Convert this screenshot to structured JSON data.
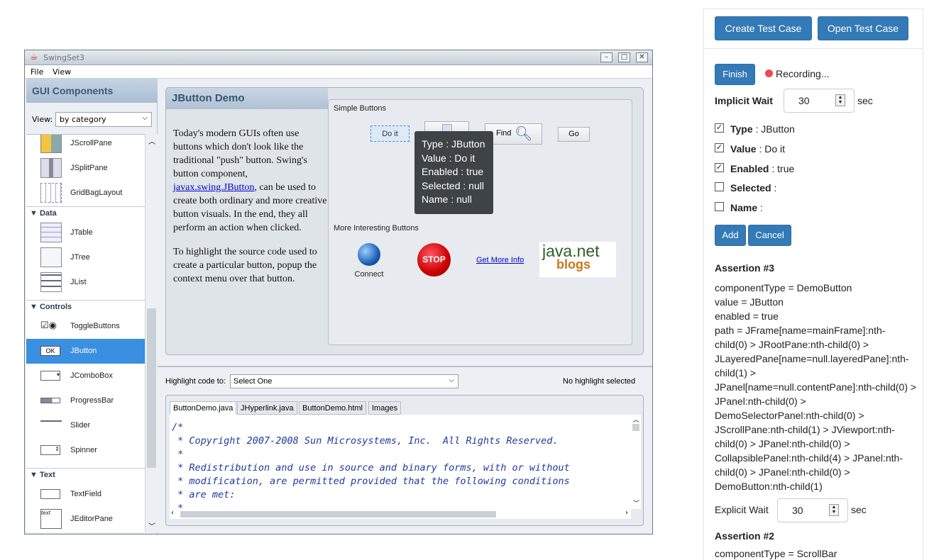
{
  "window": {
    "title": "SwingSet3",
    "menu": [
      "File",
      "View"
    ]
  },
  "left_panel": {
    "title": "GUI Components",
    "view_label": "View:",
    "view_value": "by category",
    "items_top": [
      "JScrollPane",
      "JSplitPane",
      "GridBagLayout"
    ],
    "categories": [
      {
        "name": "Data",
        "items": [
          "JTable",
          "JTree",
          "JList"
        ]
      },
      {
        "name": "Controls",
        "items": [
          "ToggleButtons",
          "JButton",
          "JComboBox",
          "ProgressBar",
          "Slider",
          "Spinner"
        ]
      },
      {
        "name": "Text",
        "items": [
          "TextField",
          "JEditorPane"
        ]
      }
    ],
    "selected": "JButton"
  },
  "demo": {
    "title": "JButton Demo",
    "text_before_link": "Today's modern GUIs often use buttons which don't look like the traditional \"push\" button. Swing's button component,",
    "link": "javax.swing.JButton",
    "text_after_link": ", can be used to create both ordinary and more creative button visuals. In the end, they all perform an action when clicked.",
    "text_2": "To highlight the source code used to create a particular button, popup the context menu over that button.",
    "simple_label": "Simple Buttons",
    "do_it": "Do it",
    "find": "Find",
    "go": "Go",
    "tooltip": [
      "Type : JButton",
      "Value : Do it",
      "Enabled : true",
      "Selected : null",
      "Name : null"
    ],
    "interesting_label": "More Interesting Buttons",
    "connect": "Connect",
    "stop": "STOP",
    "get_more_info": "Get More Info",
    "java_net": "java.net",
    "blogs": "blogs"
  },
  "highlight": {
    "label": "Highlight code to:",
    "value": "Select One",
    "status": "No highlight selected"
  },
  "code_tabs": [
    "ButtonDemo.java",
    "JHyperlink.java",
    "ButtonDemo.html",
    "Images"
  ],
  "code_lines": [
    "/*",
    " * Copyright 2007-2008 Sun Microsystems, Inc.  All Rights Reserved.",
    " *",
    " * Redistribution and use in source and binary forms, with or without",
    " * modification, are permitted provided that the following conditions",
    " * are met:",
    " *"
  ],
  "recorder": {
    "create_test_case": "Create Test Case",
    "open_test_case": "Open Test Case",
    "finish": "Finish",
    "recording": "Recording...",
    "implicit_wait_label": "Implicit Wait",
    "implicit_wait_value": "30",
    "sec": "sec",
    "props": [
      {
        "name": "Type",
        "value": ": JButton",
        "checked": true
      },
      {
        "name": "Value",
        "value": ": Do it",
        "checked": true
      },
      {
        "name": "Enabled",
        "value": ": true",
        "checked": true
      },
      {
        "name": "Selected",
        "value": ":",
        "checked": false
      },
      {
        "name": "Name",
        "value": ":",
        "checked": false
      }
    ],
    "add": "Add",
    "cancel": "Cancel",
    "assertion3_title": "Assertion #3",
    "assertion3_text": "componentType = DemoButton\nvalue = JButton\nenabled = true\npath = JFrame[name=mainFrame]:nth-child(0) > JRootPane:nth-child(0) > JLayeredPane[name=null.layeredPane]:nth-child(1) > JPanel[name=null.contentPane]:nth-child(0) > JPanel:nth-child(0) > DemoSelectorPanel:nth-child(0) > JScrollPane:nth-child(1) > JViewport:nth-child(0) > JPanel:nth-child(0) > CollapsiblePanel:nth-child(4) > JPanel:nth-child(0) > JPanel:nth-child(0) > DemoButton:nth-child(1)",
    "explicit_wait_label": "Explicit Wait",
    "explicit_wait_value": "30",
    "assertion2_title": "Assertion #2",
    "assertion2_text": "componentType = ScrollBar"
  },
  "colors": {
    "accent": "#337ab7",
    "selection": "#3a8fe0",
    "tooltip": "#3e4347",
    "recording_dot": "#f04a4a"
  }
}
